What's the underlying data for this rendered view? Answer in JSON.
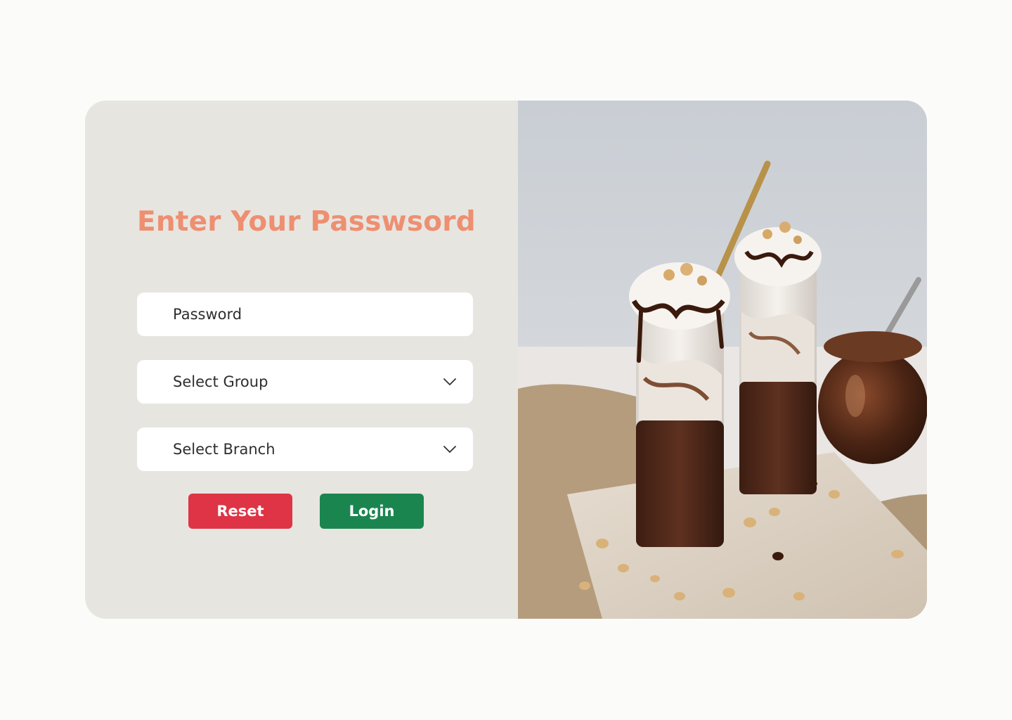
{
  "form": {
    "title": "Enter Your Passwsord",
    "password_placeholder": "Password",
    "group_select_value": "Select Group",
    "branch_select_value": "Select Branch",
    "reset_label": "Reset",
    "login_label": "Login"
  },
  "icons": {
    "dropdown": "chevron-down-icon"
  },
  "colors": {
    "title": "#ee8f71",
    "reset_button": "#de3445",
    "login_button": "#1b8550",
    "panel_background": "#e7e5e0",
    "page_background": "#fbfbfa"
  }
}
